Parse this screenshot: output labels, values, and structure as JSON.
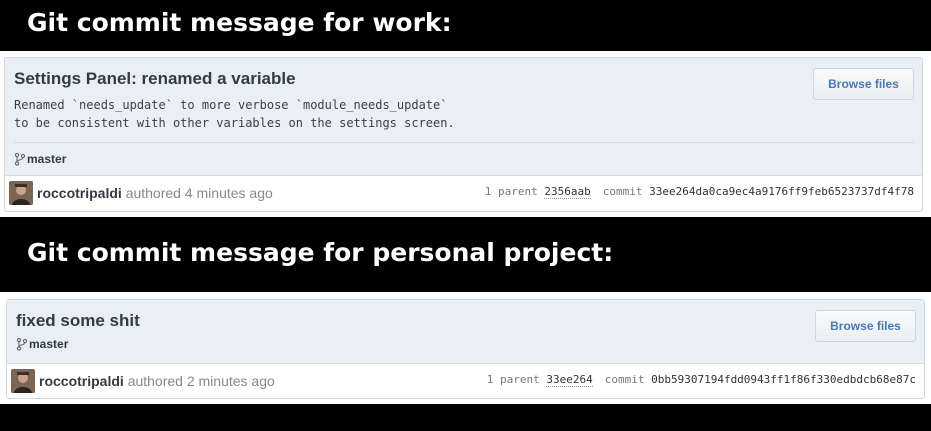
{
  "captions": {
    "work": "Git commit message for work:",
    "personal": "Git commit message for personal project:"
  },
  "colors": {
    "background": "#000000",
    "card_header_bg": "#e8f0f6",
    "link_blue": "#4a78b0",
    "title_text": "#333c44"
  },
  "work_commit": {
    "title": "Settings Panel: renamed a variable",
    "description": "Renamed `needs_update` to more verbose `module_needs_update`\nto be consistent with other variables on the settings screen.",
    "branch": "master",
    "branch_icon": "git-branch-icon",
    "browse_label": "Browse files",
    "author": "roccotripaldi",
    "authored_text": "authored 4 minutes ago",
    "parent_label": "1 parent",
    "parent_sha": "2356aab",
    "commit_label": "commit",
    "commit_sha": "33ee264da0ca9ec4a9176ff9feb6523737df4f78"
  },
  "personal_commit": {
    "title": "fixed some shit",
    "branch": "master",
    "branch_icon": "git-branch-icon",
    "browse_label": "Browse files",
    "author": "roccotripaldi",
    "authored_text": "authored 2 minutes ago",
    "parent_label": "1 parent",
    "parent_sha": "33ee264",
    "commit_label": "commit",
    "commit_sha": "0bb59307194fdd0943ff1f86f330edbdcb68e87c"
  }
}
